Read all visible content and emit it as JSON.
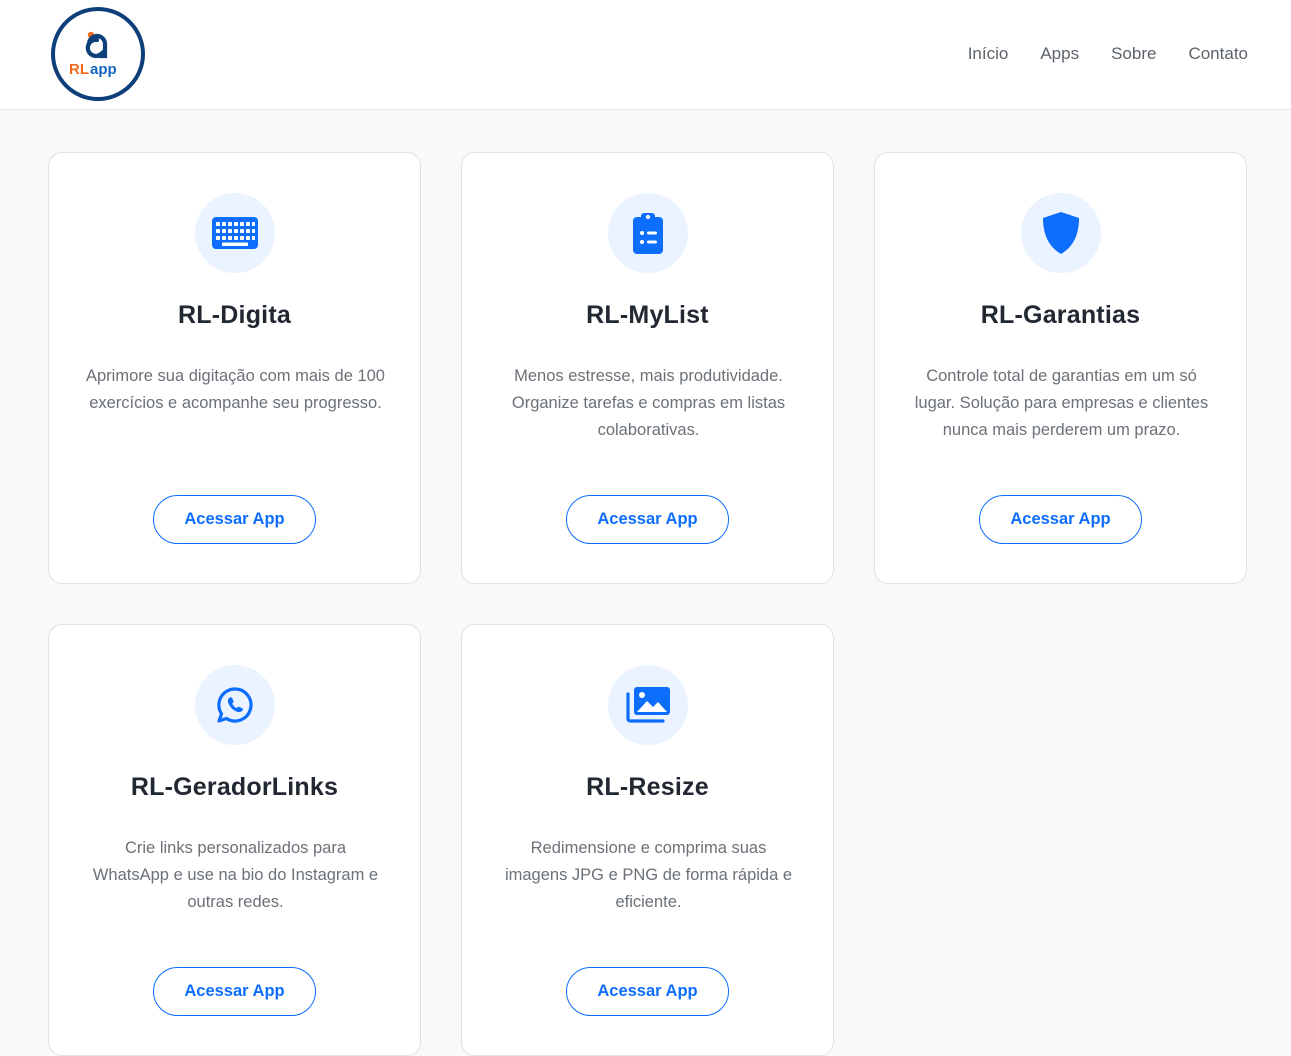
{
  "header": {
    "logo_text": "RLapp",
    "nav": [
      "Início",
      "Apps",
      "Sobre",
      "Contato"
    ]
  },
  "colors": {
    "accent": "#0d6efd",
    "logo_ring": "#0d3f7a",
    "logo_orange": "#f26a1b",
    "icon_bg": "#eaf3ff"
  },
  "cards": [
    {
      "icon": "keyboard-icon",
      "title": "RL-Digita",
      "desc": "Aprimore sua digitação com mais de 100 exercícios e acompanhe seu progresso.",
      "button": "Acessar App"
    },
    {
      "icon": "clipboard-list-icon",
      "title": "RL-MyList",
      "desc": "Menos estresse, mais produtividade. Organize tarefas e compras em listas colaborativas.",
      "button": "Acessar App"
    },
    {
      "icon": "shield-icon",
      "title": "RL-Garantias",
      "desc": "Controle total de garantias em um só lugar. Solução para empresas e clientes nunca mais perderem um prazo.",
      "button": "Acessar App"
    },
    {
      "icon": "whatsapp-icon",
      "title": "RL-GeradorLinks",
      "desc": "Crie links personalizados para WhatsApp e use na bio do Instagram e outras redes.",
      "button": "Acessar App"
    },
    {
      "icon": "images-icon",
      "title": "RL-Resize",
      "desc": "Redimensione e comprima suas imagens JPG e PNG de forma rápida e eficiente.",
      "button": "Acessar App"
    }
  ]
}
